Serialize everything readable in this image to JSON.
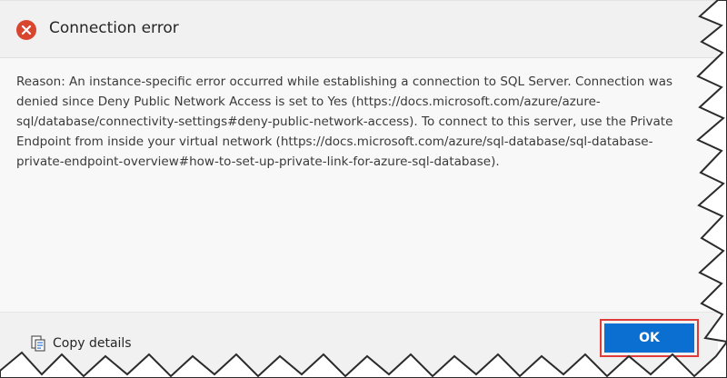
{
  "dialog": {
    "title": "Connection error",
    "title_icon": "error-circle-icon",
    "message_lines": [
      "Reason: An instance-specific error occurred while establishing a connection to SQL Server. Connection was",
      "denied since Deny Public Network Access is set to Yes (https://docs.microsoft.com/azure/azure-",
      "sql/database/connectivity-settings#deny-public-network-access). To connect to this server, use the Private",
      "Endpoint from inside your virtual network (https://docs.microsoft.com/azure/sql-database/sql-database-",
      "private-endpoint-overview#how-to-set-up-private-link-for-azure-sql-database)."
    ]
  },
  "footer": {
    "copy_details_label": "Copy details",
    "copy_icon": "copy-clipboard-icon",
    "ok_label": "OK"
  },
  "colors": {
    "error_red": "#d9462f",
    "ok_blue": "#0a6fd1",
    "highlight_red": "#e03c3c"
  }
}
